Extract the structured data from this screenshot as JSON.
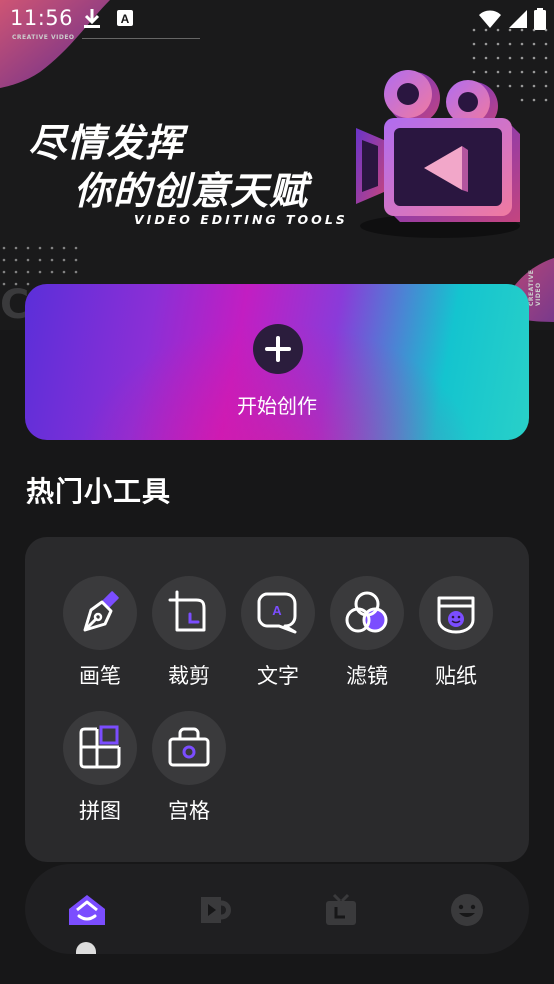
{
  "status_bar": {
    "time": "11:56",
    "icons": [
      "download-icon",
      "a-notification-icon",
      "wifi-icon",
      "signal-icon",
      "battery-icon"
    ]
  },
  "hero": {
    "slogan_line1": "尽情发挥",
    "slogan_line2": "你的创意天赋",
    "subtitle": "VIDEO EDITING TOOLS",
    "tag_top": "CREATIVE VIDEO",
    "tag_side": "CREATIVE VIDEO",
    "bg_letters": "CR",
    "illustration": "video-camera-illustration"
  },
  "start_card": {
    "label": "开始创作",
    "icon": "plus-icon"
  },
  "tools_section": {
    "title": "热门小工具",
    "tools": [
      {
        "label": "画笔",
        "icon": "pen-icon"
      },
      {
        "label": "裁剪",
        "icon": "crop-icon"
      },
      {
        "label": "文字",
        "icon": "text-bubble-icon"
      },
      {
        "label": "滤镜",
        "icon": "filter-icon"
      },
      {
        "label": "贴纸",
        "icon": "sticker-icon"
      },
      {
        "label": "拼图",
        "icon": "collage-icon"
      },
      {
        "label": "宫格",
        "icon": "grid-camera-icon"
      }
    ]
  },
  "bottom_nav": {
    "items": [
      "home-icon",
      "video-cup-icon",
      "tv-icon",
      "smiley-icon"
    ],
    "active_index": 0
  },
  "colors": {
    "accent_purple": "#7b4dff",
    "background": "#171718",
    "panel": "#2a2a2c"
  }
}
